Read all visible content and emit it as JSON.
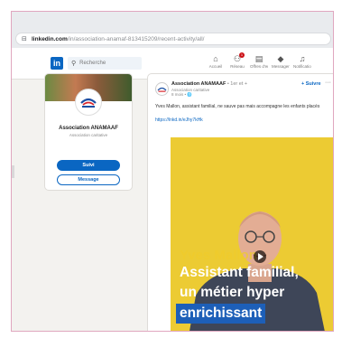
{
  "browser": {
    "url_host": "linkedin.com",
    "url_path": "/in/association-anamaf-813415209/recent-activity/all/"
  },
  "navbar": {
    "logo": "in",
    "search_placeholder": "Recherche",
    "items": [
      {
        "label": "Accueil",
        "icon": "home-icon",
        "badge": ""
      },
      {
        "label": "Réseau",
        "icon": "network-icon",
        "badge": "1"
      },
      {
        "label": "Offres d'emploi",
        "icon": "briefcase-icon",
        "badge": ""
      },
      {
        "label": "Messagerie",
        "icon": "chat-icon",
        "badge": ""
      },
      {
        "label": "Notifications",
        "icon": "bell-icon",
        "badge": ""
      }
    ]
  },
  "profile": {
    "org_name": "Association ANAMAAF",
    "org_type": "Association caritative",
    "follow_label": "Suivi",
    "message_label": "Message"
  },
  "post": {
    "author": "Association ANAMAAF",
    "degree": " • 1er et +",
    "meta1": "Association caritative",
    "meta2": "8 mois • 🌐",
    "follow_label": "+ Suivre",
    "text": "Yves Mallon, assistant familial, ne sauve pas mais accompagne les enfants placés",
    "link": "https://lnkd.in/eJhy7kHk",
    "video": {
      "caption_name": "Yves Mallon",
      "caption_line1": "Assistant familial,",
      "caption_line2": "un métier hyper",
      "caption_line3": "enrichissant"
    }
  },
  "colors": {
    "accent": "#0a66c2",
    "video_bg": "#eccb33",
    "frame": "#e0a7bf"
  }
}
